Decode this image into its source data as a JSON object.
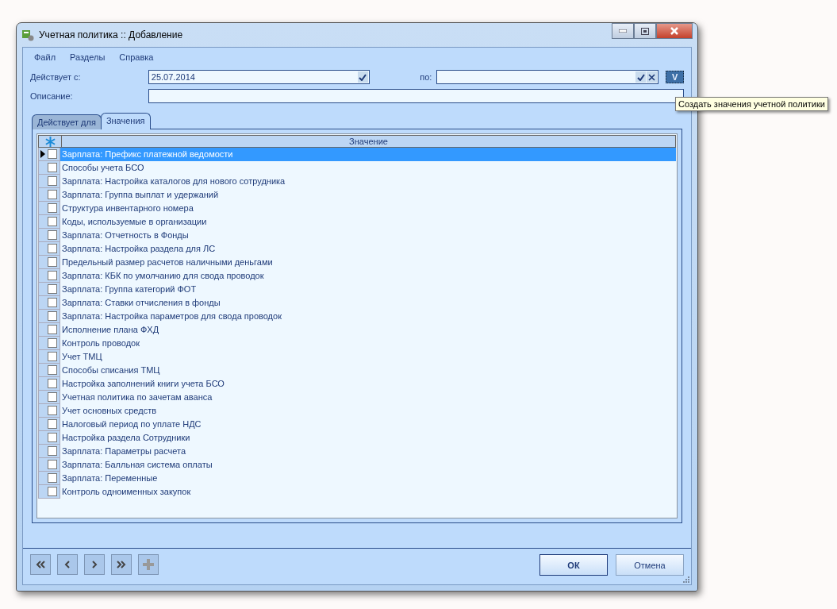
{
  "window": {
    "title": "Учетная политика :: Добавление"
  },
  "menu": [
    {
      "label": "Файл"
    },
    {
      "label": "Разделы"
    },
    {
      "label": "Справка"
    }
  ],
  "form": {
    "from_label": "Действует с:",
    "from_value": "25.07.2014",
    "to_label": "по:",
    "description_label": "Описание:"
  },
  "create_button": {
    "label": "V",
    "tooltip": "Создать значения учетной политики"
  },
  "tabs": [
    {
      "label": "Действует для",
      "selected": false
    },
    {
      "label": "Значения",
      "selected": true
    }
  ],
  "grid": {
    "column": "Значение",
    "rows": [
      {
        "value": "Зарплата: Префикс платежной ведомости",
        "selected": true,
        "checked": false
      },
      {
        "value": "Способы учета БСО",
        "selected": false,
        "checked": false
      },
      {
        "value": "Зарплата: Настройка каталогов для нового сотрудника",
        "selected": false,
        "checked": false
      },
      {
        "value": "Зарплата: Группа выплат и удержаний",
        "selected": false,
        "checked": false
      },
      {
        "value": "Структура инвентарного номера",
        "selected": false,
        "checked": false
      },
      {
        "value": "Коды, используемые в организации",
        "selected": false,
        "checked": false
      },
      {
        "value": "Зарплата: Отчетность в Фонды",
        "selected": false,
        "checked": false
      },
      {
        "value": "Зарплата: Настройка раздела для ЛС",
        "selected": false,
        "checked": false
      },
      {
        "value": "Предельный размер расчетов наличными деньгами",
        "selected": false,
        "checked": false
      },
      {
        "value": "Зарплата: КБК по умолчанию для свода проводок",
        "selected": false,
        "checked": false
      },
      {
        "value": "Зарплата: Группа категорий ФОТ",
        "selected": false,
        "checked": false
      },
      {
        "value": "Зарплата: Ставки отчисления в фонды",
        "selected": false,
        "checked": false
      },
      {
        "value": "Зарплата: Настройка параметров для свода проводок",
        "selected": false,
        "checked": false
      },
      {
        "value": "Исполнение плана ФХД",
        "selected": false,
        "checked": false
      },
      {
        "value": "Контроль проводок",
        "selected": false,
        "checked": false
      },
      {
        "value": "Учет ТМЦ",
        "selected": false,
        "checked": false
      },
      {
        "value": "Способы списания ТМЦ",
        "selected": false,
        "checked": false
      },
      {
        "value": "Настройка заполнений книги учета БСО",
        "selected": false,
        "checked": false
      },
      {
        "value": "Учетная политика по зачетам аванса",
        "selected": false,
        "checked": false
      },
      {
        "value": "Учет основных средств",
        "selected": false,
        "checked": false
      },
      {
        "value": "Налоговый период по уплате НДС",
        "selected": false,
        "checked": false
      },
      {
        "value": "Настройка раздела Сотрудники",
        "selected": false,
        "checked": false
      },
      {
        "value": "Зарплата: Параметры расчета",
        "selected": false,
        "checked": false
      },
      {
        "value": "Зарплата: Балльная система оплаты",
        "selected": false,
        "checked": false
      },
      {
        "value": "Зарплата: Переменные",
        "selected": false,
        "checked": false
      },
      {
        "value": "Контроль одноименных закупок",
        "selected": false,
        "checked": false
      }
    ]
  },
  "navigation": [
    {
      "kind": "first",
      "disabled": false
    },
    {
      "kind": "prev",
      "disabled": false
    },
    {
      "kind": "next",
      "disabled": false
    },
    {
      "kind": "last",
      "disabled": false
    },
    {
      "kind": "add",
      "disabled": true
    }
  ],
  "buttons": [
    {
      "label": "ОК",
      "default": true
    },
    {
      "label": "Отмена",
      "default": false
    }
  ]
}
